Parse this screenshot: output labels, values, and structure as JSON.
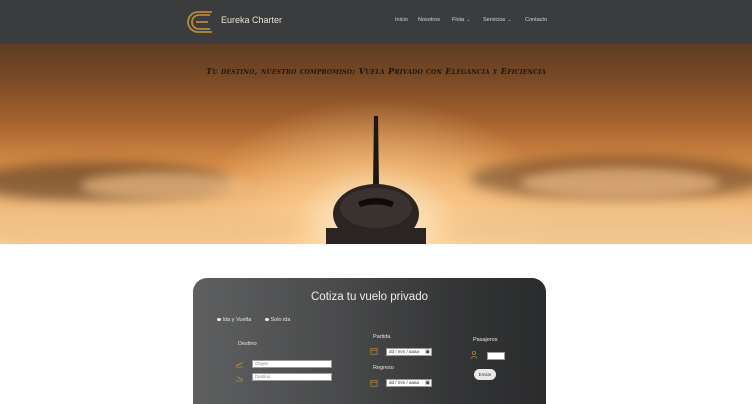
{
  "nav": {
    "brand": "Eureka Charter",
    "items": [
      {
        "label": "Inicio",
        "has_dropdown": false
      },
      {
        "label": "Nosotros",
        "has_dropdown": false
      },
      {
        "label": "Flota",
        "has_dropdown": true
      },
      {
        "label": "Servicios",
        "has_dropdown": true
      },
      {
        "label": "Contacto",
        "has_dropdown": false
      }
    ]
  },
  "hero": {
    "title": "Tu destino, nuestro compromiso: Vuela Privado con Elegancia y Eficiencia"
  },
  "form": {
    "title": "Cotiza tu vuelo privado",
    "trip_types": [
      "Ida y Vuelta",
      "Solo ida"
    ],
    "destino_label": "Destino",
    "origin_placeholder": "Origen",
    "destination_placeholder": "Destino",
    "partida_label": "Partida",
    "regreso_label": "Regreso",
    "date_placeholder": "dd / mm / aaaa",
    "pasajeros_label": "Pasajeros",
    "pasajeros_value": "",
    "submit_label": "Enviar"
  },
  "colors": {
    "nav_bg": "#3b3c3e",
    "accent_gold": "#b58a3a",
    "card_dark": "#2a2b2c"
  }
}
